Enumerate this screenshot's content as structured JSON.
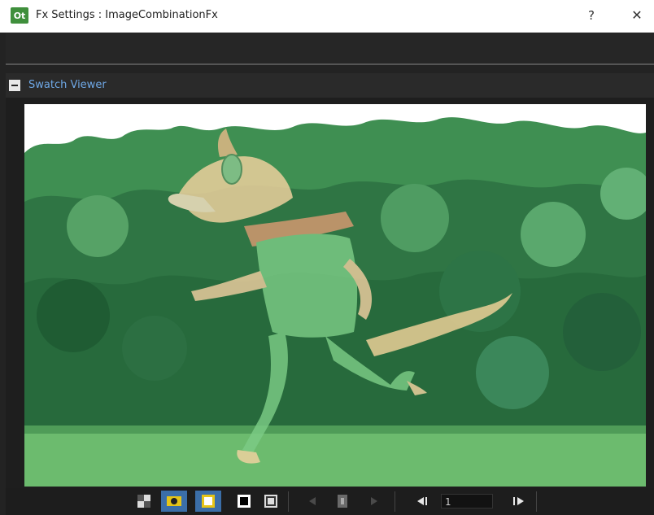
{
  "window": {
    "app_icon_text": "Ot",
    "title": "Fx Settings : ImageCombinationFx",
    "help_label": "?",
    "close_label": "✕"
  },
  "section": {
    "collapse_label": "−",
    "label": "Swatch Viewer"
  },
  "viewer": {
    "image_description_icon": "running-fox-cartoon-image"
  },
  "controls": {
    "frame_value": "1",
    "colors": {
      "active_bg": "#3b6ea8",
      "accent_yellow": "#e6c417"
    },
    "icons": [
      "checkerboard-bg-icon",
      "camera-view-icon",
      "white-bg-icon",
      "black-bg-icon",
      "checker-bg-icon",
      "prev-icon",
      "keyframe-icon",
      "next-icon",
      "prev-frame-icon",
      "next-frame-icon"
    ]
  }
}
